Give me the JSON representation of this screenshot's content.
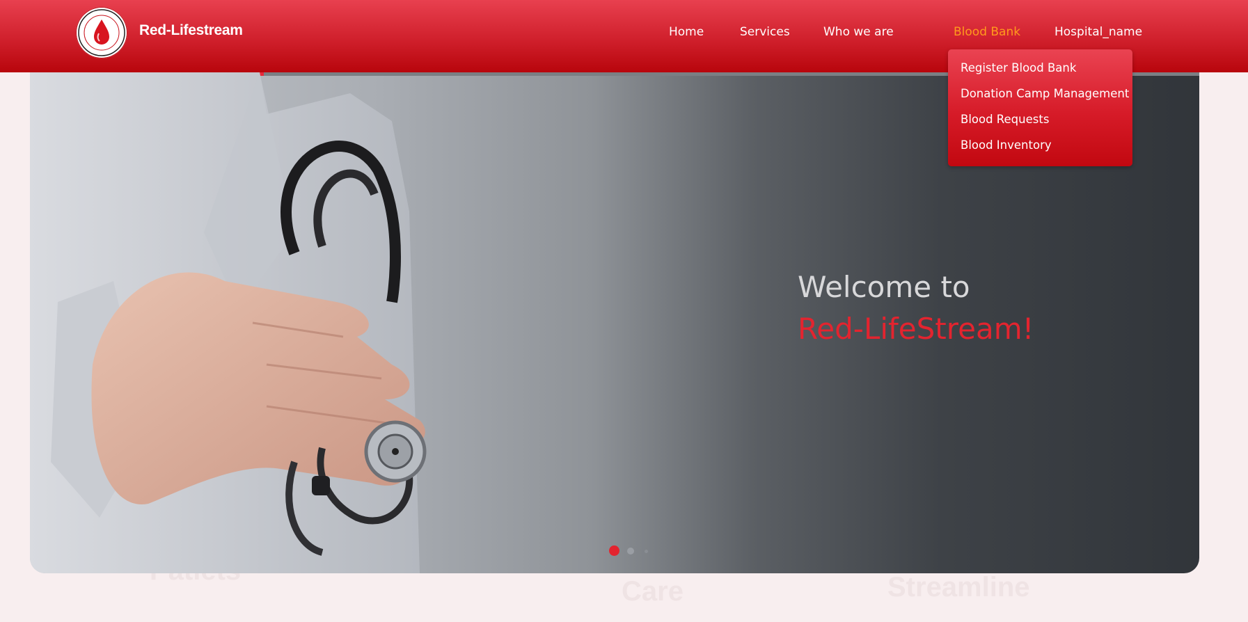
{
  "brand": {
    "name": "Red-Lifestream",
    "logo_text": "Red-LifeStream"
  },
  "nav": {
    "items": [
      {
        "label": "Home"
      },
      {
        "label": "Services"
      },
      {
        "label": "Who we are"
      },
      {
        "label": "Blood Bank",
        "active": true
      },
      {
        "label": "Hospital_name"
      }
    ]
  },
  "dropdown": {
    "items": [
      {
        "label": "Register Blood Bank"
      },
      {
        "label": "Donation Camp Management"
      },
      {
        "label": "Blood Requests"
      },
      {
        "label": "Blood Inventory"
      }
    ]
  },
  "hero": {
    "welcome": "Welcome to",
    "brandline": "Red-LifeStream!",
    "slides_total": 3,
    "active_slide": 1,
    "progress": 0.2
  },
  "background": {
    "word_left": "Patiets",
    "word_mid": "Care",
    "word_right": "Streamline"
  },
  "colors": {
    "accent": "#e3242f",
    "nav_active": "#ff9a1c"
  }
}
